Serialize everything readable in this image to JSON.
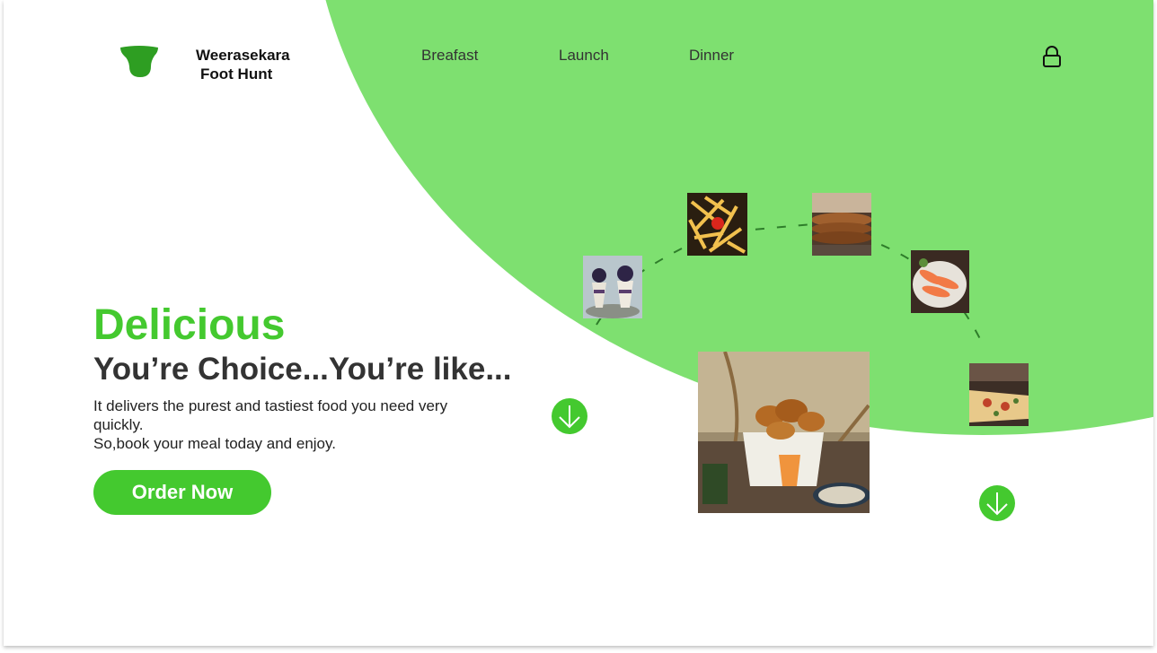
{
  "brand": {
    "line1": "Weerasekara",
    "line2": "Foot Hunt",
    "logo_icon": "tooth-logo-icon"
  },
  "nav": {
    "items": [
      {
        "label": "Breafast"
      },
      {
        "label": "Launch"
      },
      {
        "label": "Dinner"
      }
    ],
    "lock_icon": "lock-icon"
  },
  "hero": {
    "title": "Delicious",
    "subtitle": "You’re Choice...You’re like...",
    "desc_line1": "It delivers the purest and tastiest food you need very quickly.",
    "desc_line2": "So,book your meal today and enjoy.",
    "order_button": "Order Now"
  },
  "images": [
    {
      "name": "dessert-parfait-image"
    },
    {
      "name": "french-fries-image"
    },
    {
      "name": "pancake-stack-image"
    },
    {
      "name": "salmon-platter-image"
    },
    {
      "name": "pizza-slice-image"
    },
    {
      "name": "croissant-basket-image"
    }
  ],
  "colors": {
    "accent": "#44C92F",
    "blob": "#7EE070",
    "text": "#333333"
  }
}
